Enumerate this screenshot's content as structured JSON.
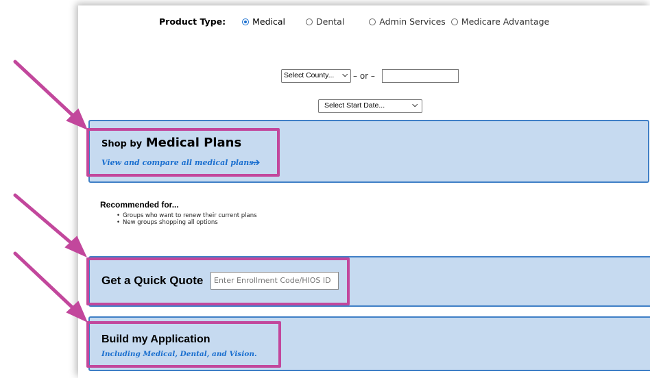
{
  "product_type": {
    "label": "Product Type:",
    "options": [
      {
        "label": "Medical",
        "selected": true
      },
      {
        "label": "Dental",
        "selected": false
      },
      {
        "label": "Admin Services",
        "selected": false
      },
      {
        "label": "Medicare Advantage",
        "selected": false
      }
    ]
  },
  "location": {
    "county_select": "Select County...",
    "or_text": "– or –",
    "zip_value": ""
  },
  "start_date_select": "Select Start Date...",
  "shop": {
    "title_prefix": "Shop by",
    "title_main": "Medical Plans",
    "link": "View and compare all medical plans."
  },
  "recommended": {
    "title": "Recommended for...",
    "items": [
      "Groups who want to renew their current plans",
      "New groups shopping all options"
    ]
  },
  "quick_quote": {
    "title": "Get a Quick Quote",
    "placeholder": "Enter Enrollment Code/HIOS ID"
  },
  "build": {
    "title": "Build my Application",
    "subtitle": "Including Medical, Dental, and Vision."
  },
  "colors": {
    "panel_blue": "#c6daf0",
    "panel_border": "#3f7fc6",
    "highlight": "#c2479c",
    "link_blue": "#1a6fcf"
  }
}
